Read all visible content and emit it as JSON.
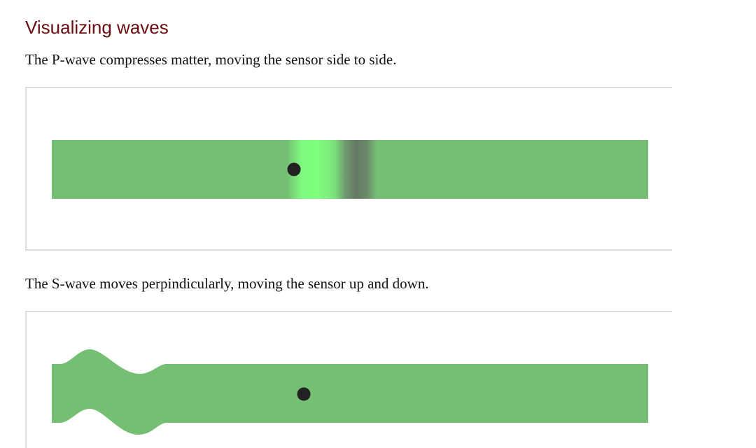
{
  "heading": "Visualizing waves",
  "p_wave": {
    "description": "The P-wave compresses matter, moving the sensor side to side."
  },
  "s_wave": {
    "description": "The S-wave moves perpindicularly, moving the sensor up and down."
  },
  "colors": {
    "heading": "#6b0d10",
    "medium": "#74bf74",
    "rarefaction": "#7dfa7d",
    "compression": "#657a65",
    "sensor": "#222222",
    "panel_border": "#dcdcdc"
  }
}
